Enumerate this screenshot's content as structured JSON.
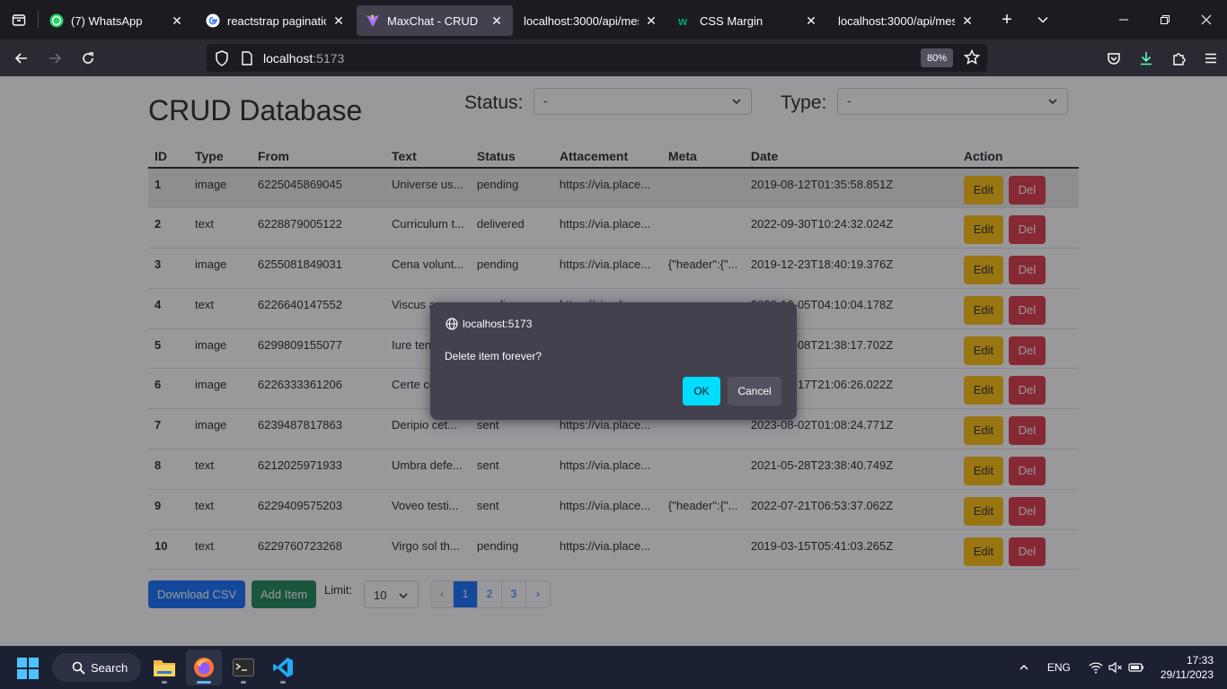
{
  "browser": {
    "tabs": [
      {
        "title": "(7) WhatsApp",
        "icon": "whatsapp-icon",
        "active": false
      },
      {
        "title": "reactstrap pagination -",
        "icon": "google-icon",
        "active": false
      },
      {
        "title": "MaxChat - CRUD",
        "icon": "vite-icon",
        "active": true
      },
      {
        "title": "localhost:3000/api/messag",
        "icon": "none",
        "active": false
      },
      {
        "title": "CSS Margin",
        "icon": "w3schools-icon",
        "active": false
      },
      {
        "title": "localhost:3000/api/messag",
        "icon": "none",
        "active": false
      }
    ],
    "url_host": "localhost",
    "url_port": ":5173",
    "zoom": "80%"
  },
  "page": {
    "title": "CRUD Database",
    "status_label": "Status:",
    "status_value": "-",
    "type_label": "Type:",
    "type_value": "-",
    "columns": [
      "ID",
      "Type",
      "From",
      "Text",
      "Status",
      "Attacement",
      "Meta",
      "Date",
      "Action"
    ],
    "rows": [
      {
        "id": "1",
        "type": "image",
        "from": "6225045869045",
        "text": "Universe us...",
        "status": "pending",
        "attachment": "https://via.place...",
        "meta": "",
        "date": "2019-08-12T01:35:58.851Z"
      },
      {
        "id": "2",
        "type": "text",
        "from": "6228879005122",
        "text": "Curriculum t...",
        "status": "delivered",
        "attachment": "https://via.place...",
        "meta": "",
        "date": "2022-09-30T10:24:32.024Z"
      },
      {
        "id": "3",
        "type": "image",
        "from": "6255081849031",
        "text": "Cena volunt...",
        "status": "pending",
        "attachment": "https://via.place...",
        "meta": "{\"header\":{\"...",
        "date": "2019-12-23T18:40:19.376Z"
      },
      {
        "id": "4",
        "type": "text",
        "from": "6226640147552",
        "text": "Viscus au",
        "status": "pending",
        "attachment": "https://via.pla",
        "meta": "",
        "date": "2020-10-05T04:10:04.178Z"
      },
      {
        "id": "5",
        "type": "image",
        "from": "6299809155077",
        "text": "Iure tenu",
        "status": "",
        "attachment": "",
        "meta": "",
        "date": "2019-10-08T21:38:17.702Z"
      },
      {
        "id": "6",
        "type": "image",
        "from": "6226333361206",
        "text": "Certe co",
        "status": "",
        "attachment": "",
        "meta": "",
        "date": "2021-03-17T21:06:26.022Z"
      },
      {
        "id": "7",
        "type": "image",
        "from": "6239487817863",
        "text": "Deripio cet...",
        "status": "sent",
        "attachment": "https://via.place...",
        "meta": "",
        "date": "2023-08-02T01:08:24.771Z"
      },
      {
        "id": "8",
        "type": "text",
        "from": "6212025971933",
        "text": "Umbra defe...",
        "status": "sent",
        "attachment": "https://via.place...",
        "meta": "",
        "date": "2021-05-28T23:38:40.749Z"
      },
      {
        "id": "9",
        "type": "text",
        "from": "6229409575203",
        "text": "Voveo testi...",
        "status": "sent",
        "attachment": "https://via.place...",
        "meta": "{\"header\":{\"...",
        "date": "2022-07-21T06:53:37.062Z"
      },
      {
        "id": "10",
        "type": "text",
        "from": "6229760723268",
        "text": "Virgo sol th...",
        "status": "pending",
        "attachment": "https://via.place...",
        "meta": "",
        "date": "2019-03-15T05:41:03.265Z"
      }
    ],
    "edit_label": "Edit",
    "del_label": "Del",
    "download_label": "Download CSV",
    "add_label": "Add Item",
    "limit_label": "Limit:",
    "limit_value": "10",
    "pages": [
      "‹",
      "1",
      "2",
      "3",
      "›"
    ],
    "active_page": "1"
  },
  "dialog": {
    "origin": "localhost:5173",
    "message": "Delete item forever?",
    "ok_label": "OK",
    "cancel_label": "Cancel"
  },
  "taskbar": {
    "search_label": "Search",
    "language": "ENG",
    "time": "17:33",
    "date": "29/11/2023"
  }
}
